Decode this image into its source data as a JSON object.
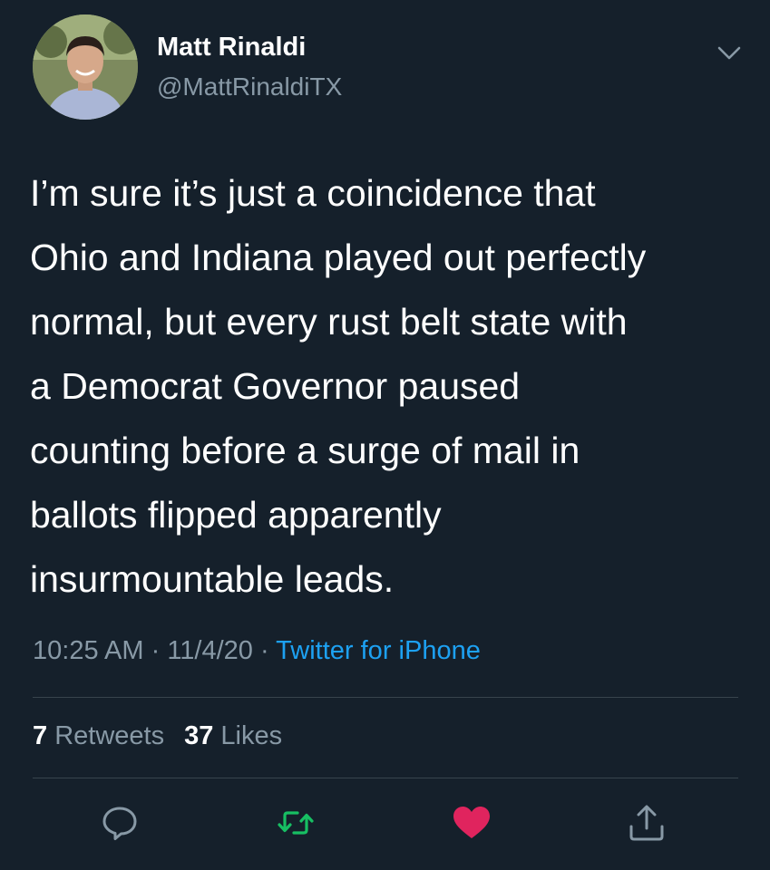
{
  "author": {
    "name": "Matt Rinaldi",
    "handle": "@MattRinaldiTX"
  },
  "tweet": {
    "lines": [
      "I’m sure it’s just a coincidence that",
      "Ohio and Indiana played out perfectly",
      "normal, but every rust belt state with",
      "a Democrat Governor paused",
      "counting before a surge of mail in",
      "ballots flipped apparently",
      "insurmountable leads."
    ]
  },
  "meta": {
    "time": "10:25 AM",
    "sep1": " · ",
    "date": "11/4/20",
    "sep2": " · ",
    "source": "Twitter for iPhone"
  },
  "stats": {
    "retweets_count": "7",
    "retweets_label": "Retweets",
    "likes_count": "37",
    "likes_label": "Likes"
  },
  "actions": {
    "reply_icon": "reply-icon",
    "retweet_icon": "retweet-icon",
    "like_icon": "heart-icon",
    "share_icon": "share-icon"
  },
  "colors": {
    "background": "#15202b",
    "secondary_text": "#8899a6",
    "link": "#1da1f2",
    "retweet_active": "#17bf63",
    "like_active": "#e0245e",
    "divider": "#38444d"
  }
}
